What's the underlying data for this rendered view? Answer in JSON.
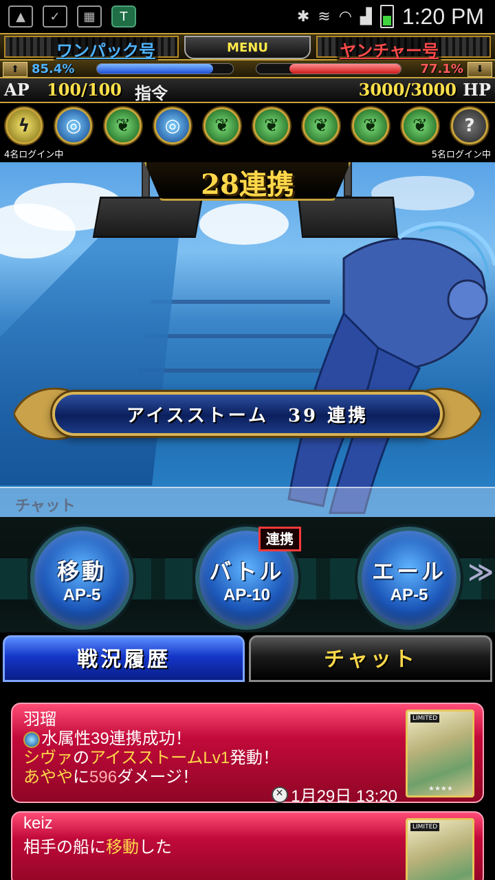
{
  "status_bar": {
    "time": "1:20 PM",
    "icons": [
      "gallery-icon",
      "sim-check-icon",
      "calendar-icon",
      "shield-app-icon",
      "bluetooth-icon",
      "vibrate-icon",
      "wifi-icon",
      "signal-icon",
      "battery-icon"
    ]
  },
  "header": {
    "team_left": "ワンパック号",
    "team_right": "ヤンチャー号",
    "menu_label": "MENU",
    "pct_left": "85.4%",
    "pct_right": "77.1%",
    "gauge_left_fraction": 0.854,
    "gauge_right_fraction": 0.771,
    "ap_label": "AP",
    "ap_value": "100/100",
    "order_label": "指令",
    "hp_value": "3000/3000",
    "hp_label": "HP",
    "colors": {
      "team_left": "#4fb3ff",
      "team_right": "#ff4a4a",
      "gold": "#c9a43a"
    }
  },
  "elements": {
    "icons": [
      {
        "type": "thunder",
        "glyph": "ϟ"
      },
      {
        "type": "water",
        "glyph": "◎"
      },
      {
        "type": "leaf",
        "glyph": "❦"
      },
      {
        "type": "water",
        "glyph": "◎"
      },
      {
        "type": "leaf",
        "glyph": "❦"
      },
      {
        "type": "leaf",
        "glyph": "❦"
      },
      {
        "type": "leaf",
        "glyph": "❦"
      },
      {
        "type": "leaf",
        "glyph": "❦"
      },
      {
        "type": "leaf",
        "glyph": "❦"
      },
      {
        "type": "unknown",
        "glyph": "?"
      }
    ],
    "login_left": "4名ログイン中",
    "login_right": "5名ログイン中"
  },
  "scene": {
    "chain_count": "28連携",
    "skill_name": "アイスストーム",
    "skill_chain": "39 連携",
    "chat_label": "チャット"
  },
  "actions": {
    "buttons": [
      {
        "name": "移動",
        "ap": "AP-5"
      },
      {
        "name": "バトル",
        "ap": "AP-10"
      },
      {
        "name": "エール",
        "ap": "AP-5"
      }
    ],
    "chain_badge": "連携",
    "more_arrow": "≫"
  },
  "tabs": {
    "history": "戦況履歴",
    "chat": "チャット"
  },
  "log": {
    "entries": [
      {
        "user": "羽瑠",
        "line1": "水属性39連携成功！",
        "line2_hl1": "シヴァ",
        "line2_mid": "の",
        "line2_hl2": "アイスストームLv1",
        "line2_end": "発動！",
        "line3_hl1": "あやや",
        "line3_mid": "に",
        "line3_dmg": "596",
        "line3_end": "ダメージ！",
        "time": "1月29日 13:20",
        "card_tag": "LIMITED"
      },
      {
        "user": "keiz",
        "line1_start": "相手の船に",
        "line1_hl": "移動",
        "line1_end": "した",
        "card_tag": "LIMITED"
      }
    ]
  }
}
